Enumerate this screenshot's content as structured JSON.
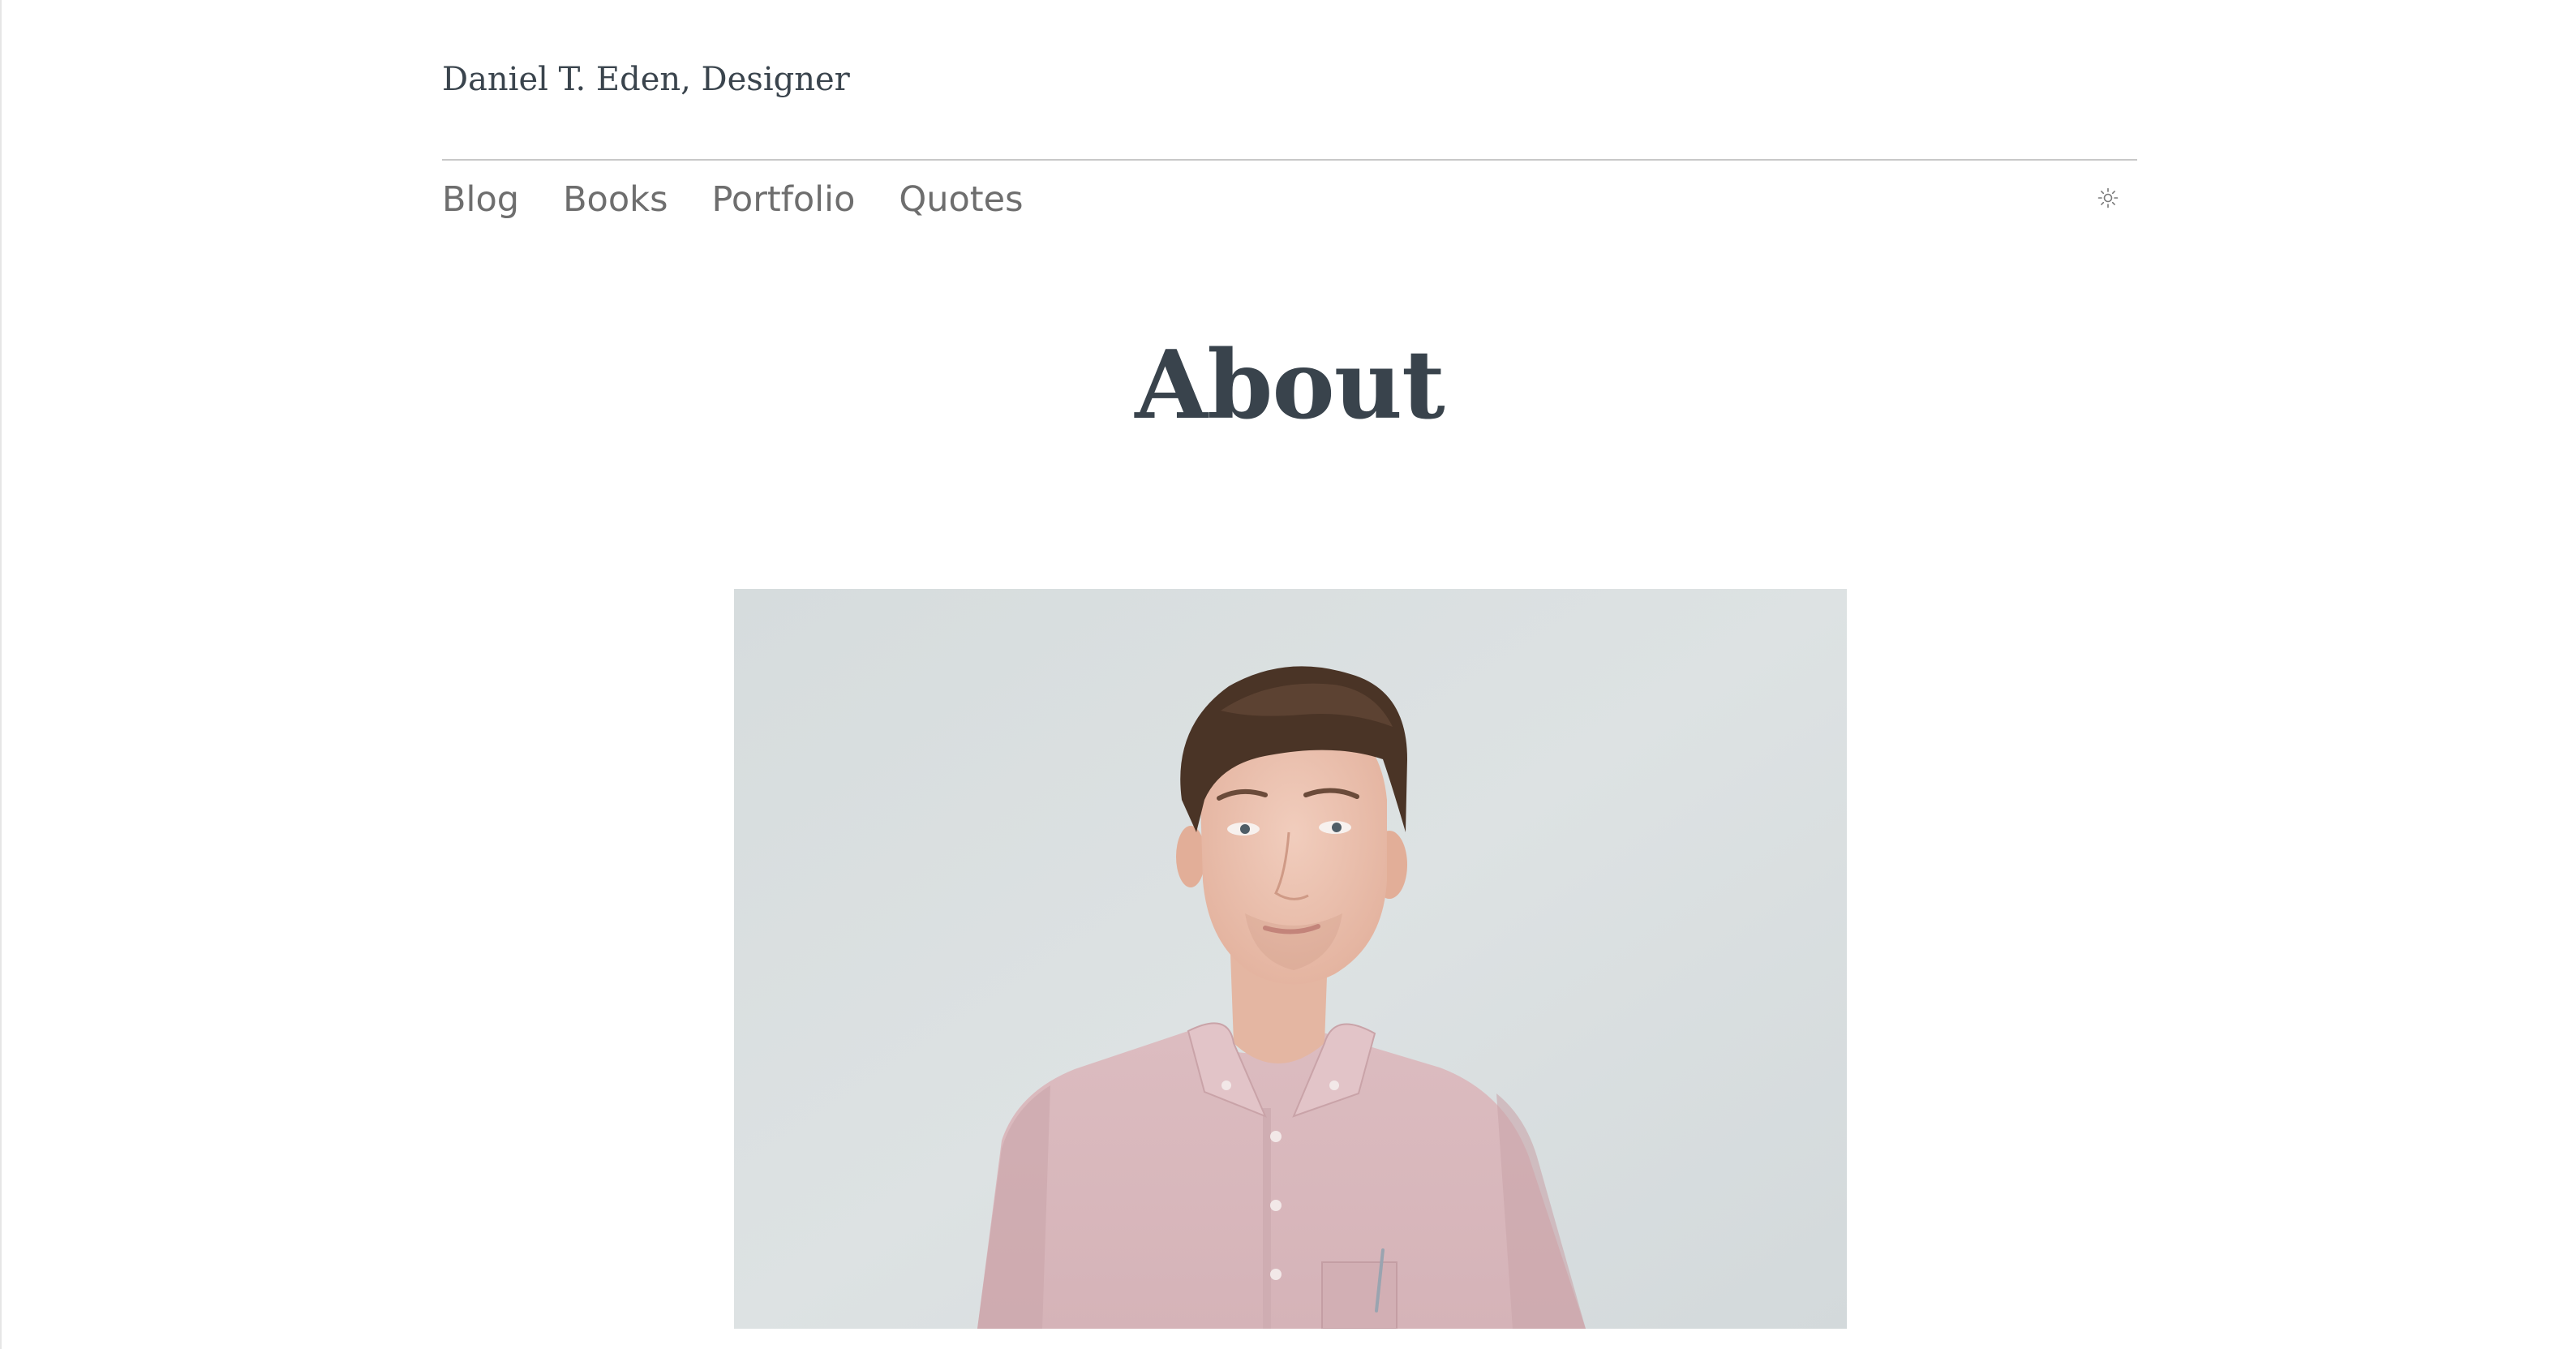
{
  "site": {
    "title": "Daniel T. Eden, Designer"
  },
  "nav": {
    "items": [
      {
        "label": "Blog"
      },
      {
        "label": "Books"
      },
      {
        "label": "Portfolio"
      },
      {
        "label": "Quotes"
      }
    ],
    "theme_toggle_icon": "sun-icon"
  },
  "page": {
    "title": "About"
  },
  "image": {
    "subject": "portrait-photo",
    "alt": ""
  },
  "colors": {
    "text": "#3a444d",
    "nav_text": "#6e6e6e",
    "divider": "#c8c8c8",
    "photo_background": "#d9dfe0",
    "shirt": "#d9b8bd"
  }
}
